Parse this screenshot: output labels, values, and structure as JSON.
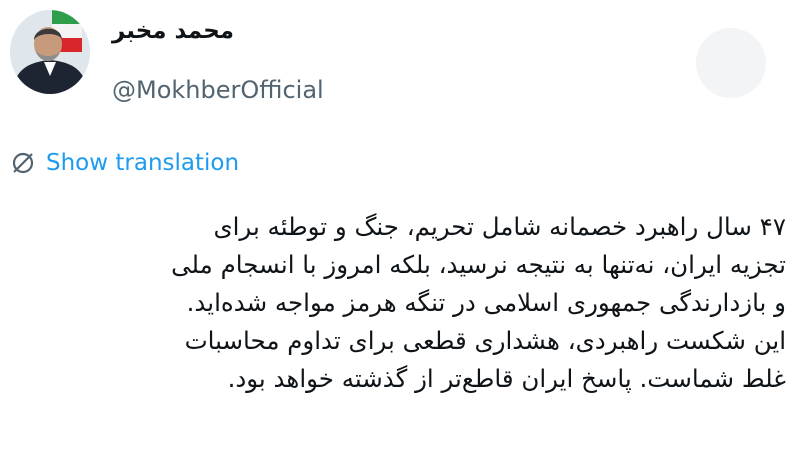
{
  "author": {
    "display_name": "محمد مخبر",
    "handle": "@MokhberOfficial",
    "avatar": "avatar-photo"
  },
  "header": {
    "more_icon": "more-options-icon"
  },
  "translation": {
    "icon": "globe-icon",
    "label": "Show translation"
  },
  "tweet": {
    "lines": [
      "۴۷ سال راهبرد خصمانه شامل تحریم، جنگ و توطئه برای",
      "تجزیه ایران، نه‌تنها به نتیجه نرسید، بلکه امروز با انسجام ملی",
      "و بازدارندگی جمهوری اسلامی در تنگه هرمز مواجه شده‌اید.",
      "این شکست راهبردی، هشداری قطعی برای تداوم محاسبات",
      "غلط شماست. پاسخ ایران قاطع‌تر از گذشته خواهد بود."
    ]
  },
  "colors": {
    "link": "#1d9bf0",
    "secondary_text": "#536471",
    "primary_text": "#0f1419"
  }
}
